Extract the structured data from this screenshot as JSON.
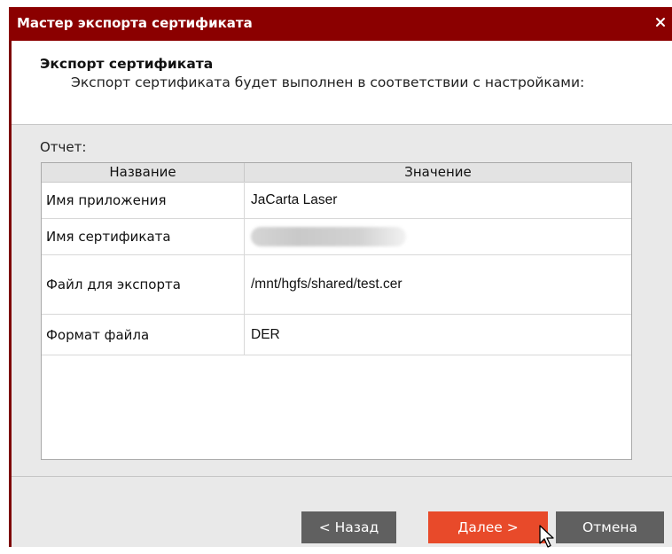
{
  "window": {
    "title": "Мастер экспорта сертификата",
    "close_glyph": "×",
    "title_bar_color": "#8b0000"
  },
  "header": {
    "title": "Экспорт сертификата",
    "subtitle": "Экспорт сертификата будет выполнен в соответствии с настройками:"
  },
  "report": {
    "label": "Отчет:",
    "columns": [
      "Название",
      "Значение"
    ],
    "rows": [
      {
        "name": "Имя приложения",
        "value": "JaCarta Laser"
      },
      {
        "name": "Имя сертификата",
        "value": "",
        "value_redacted": true
      },
      {
        "name": "Файл для экспорта",
        "value": "/mnt/hgfs/shared/test.cer"
      },
      {
        "name": "Формат файла",
        "value": "DER"
      }
    ]
  },
  "buttons": {
    "back": "< Назад",
    "next": "Далее >",
    "cancel": "Отмена",
    "accent_color": "#e84a2a",
    "secondary_color": "#606060"
  },
  "icons": {
    "close": "close-icon",
    "pointer": "mouse-pointer-icon"
  }
}
